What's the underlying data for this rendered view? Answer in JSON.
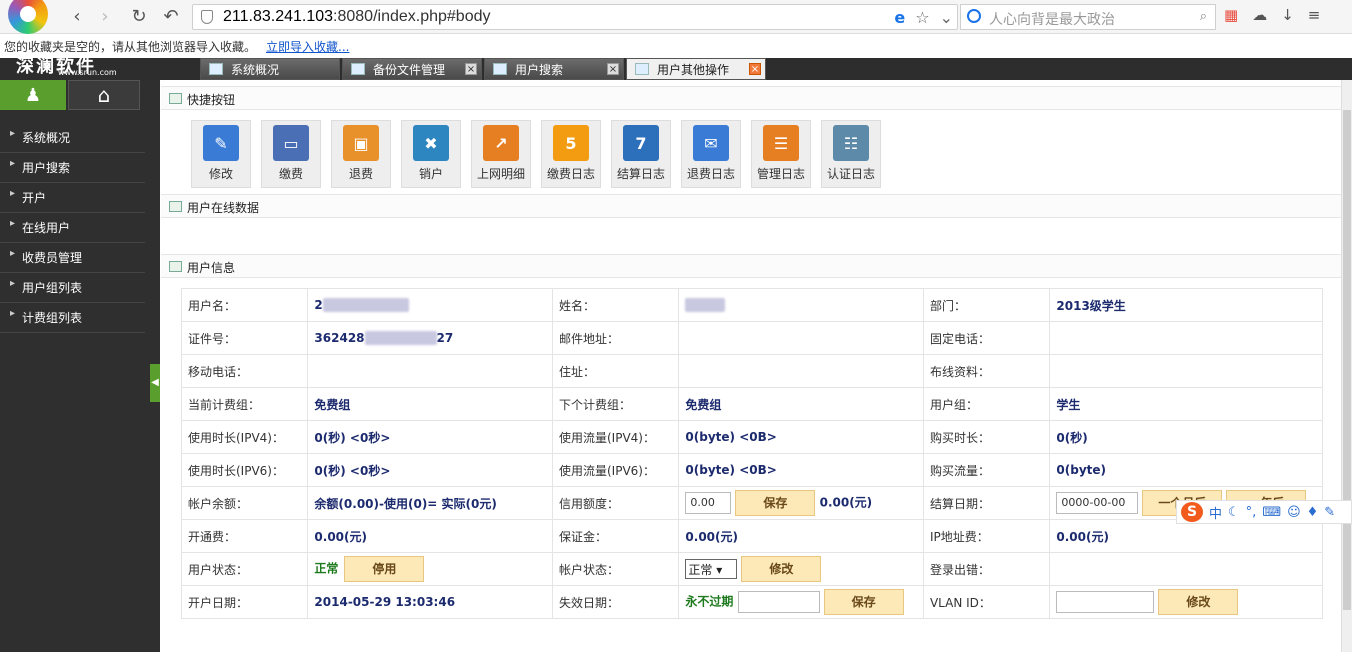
{
  "browser": {
    "url_host": "211.83.241.103",
    "url_rest": ":8080/index.php#body",
    "search_placeholder": "人心向背是最大政治",
    "bookmark_msg": "您的收藏夹是空的，请从其他浏览器导入收藏。",
    "bookmark_link": "立即导入收藏..."
  },
  "app": {
    "brand": "深澜软件",
    "brand_url": "www.srun.com",
    "tabs": [
      {
        "label": "系统概况"
      },
      {
        "label": "备份文件管理"
      },
      {
        "label": "用户搜索"
      },
      {
        "label": "用户其他操作"
      }
    ]
  },
  "sidebar": {
    "items": [
      {
        "label": "系统概况"
      },
      {
        "label": "用户搜索"
      },
      {
        "label": "开户"
      },
      {
        "label": "在线用户"
      },
      {
        "label": "收费员管理"
      },
      {
        "label": "用户组列表"
      },
      {
        "label": "计费组列表"
      }
    ]
  },
  "sections": {
    "quick": "快捷按钮",
    "online": "用户在线数据",
    "info": "用户信息"
  },
  "quick_buttons": [
    {
      "label": "修改",
      "icon": "edit-icon",
      "color": "#3a7bd5"
    },
    {
      "label": "缴费",
      "icon": "card-icon",
      "color": "#4a6fb5"
    },
    {
      "label": "退费",
      "icon": "wallet-icon",
      "color": "#e8912a"
    },
    {
      "label": "销户",
      "icon": "user-remove-icon",
      "color": "#2e86c1"
    },
    {
      "label": "上网明细",
      "icon": "chart-icon",
      "color": "#e67e22"
    },
    {
      "label": "缴费日志",
      "icon": "calendar-5-icon",
      "color": "#f39c12"
    },
    {
      "label": "结算日志",
      "icon": "calendar-7-icon",
      "color": "#2c6fbb"
    },
    {
      "label": "退费日志",
      "icon": "mail-icon",
      "color": "#3a7bd5"
    },
    {
      "label": "管理日志",
      "icon": "log-icon",
      "color": "#e67e22"
    },
    {
      "label": "认证日志",
      "icon": "id-card-icon",
      "color": "#5d8aa8"
    }
  ],
  "info": {
    "username_label": "用户名：",
    "username_val": "2",
    "name_label": "姓名：",
    "dept_label": "部门：",
    "dept_val": "2013级学生",
    "id_label": "证件号：",
    "id_val_a": "362428",
    "id_val_b": "27",
    "email_label": "邮件地址：",
    "phone_label": "固定电话：",
    "mobile_label": "移动电话：",
    "address_label": "住址：",
    "wiring_label": "布线资料：",
    "billgroup_label": "当前计费组：",
    "billgroup_val": "免费组",
    "nextgroup_label": "下个计费组：",
    "nextgroup_val": "免费组",
    "usergroup_label": "用户组：",
    "usergroup_val": "学生",
    "time4_label": "使用时长(IPV4)：",
    "time4_val": "0(秒) <0秒>",
    "flow4_label": "使用流量(IPV4)：",
    "flow4_val": "0(byte) <0B>",
    "buytime_label": "购买时长：",
    "buytime_val": "0(秒)",
    "time6_label": "使用时长(IPV6)：",
    "time6_val": "0(秒) <0秒>",
    "flow6_label": "使用流量(IPV6)：",
    "flow6_val": "0(byte) <0B>",
    "buyflow_label": "购买流量：",
    "buyflow_val": "0(byte)",
    "balance_label": "帐户余额：",
    "balance_val": "余额(0.00)-使用(0)= 实际(0元)",
    "credit_label": "信用额度：",
    "credit_input": "0.00",
    "credit_save": "保存",
    "credit_val": "0.00(元)",
    "settle_label": "结算日期：",
    "settle_input": "0000-00-00",
    "settle_btn1": "一个月后",
    "settle_btn2": "一年后",
    "open_fee_label": "开通费：",
    "open_fee_val": "0.00(元)",
    "deposit_label": "保证金：",
    "deposit_val": "0.00(元)",
    "ip_fee_label": "IP地址费：",
    "ip_fee_val": "0.00(元)",
    "ustatus_label": "用户状态：",
    "ustatus_val": "正常",
    "ustatus_btn": "停用",
    "astatus_label": "帐户状态：",
    "astatus_sel": "正常",
    "astatus_btn": "修改",
    "loginerr_label": "登录出错：",
    "opendate_label": "开户日期：",
    "opendate_val": "2014-05-29 13:03:46",
    "expire_label": "失效日期：",
    "expire_val": "永不过期",
    "expire_btn": "保存",
    "vlan_label": "VLAN ID：",
    "vlan_btn": "修改"
  },
  "ime": {
    "logo": "S",
    "mode": "中"
  }
}
